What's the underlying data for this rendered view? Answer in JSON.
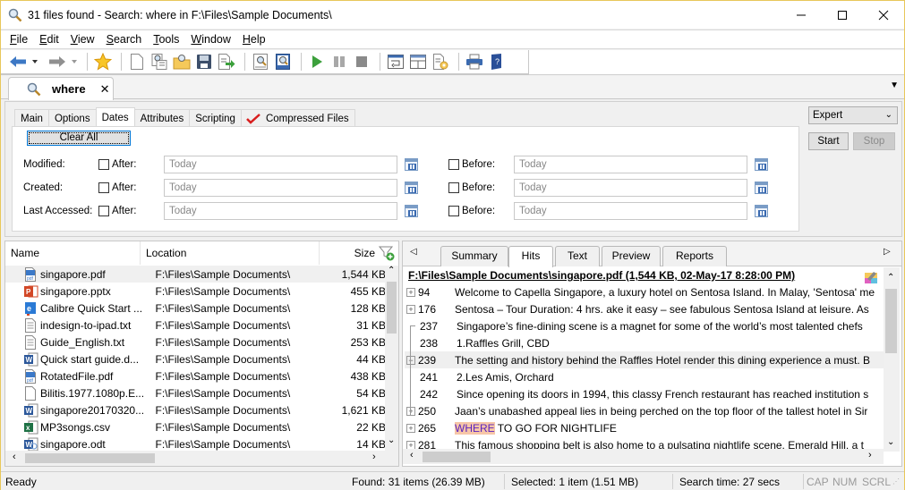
{
  "window": {
    "title": "31 files found - Search: where in F:\\Files\\Sample Documents\\",
    "minimize": "—",
    "maximize": "☐",
    "close": "✕"
  },
  "menu": [
    {
      "label": "File",
      "u": "F",
      "rest": "ile"
    },
    {
      "label": "Edit",
      "u": "E",
      "rest": "dit"
    },
    {
      "label": "View",
      "u": "V",
      "rest": "iew"
    },
    {
      "label": "Search",
      "u": "S",
      "rest": "earch"
    },
    {
      "label": "Tools",
      "u": "T",
      "rest": "ools"
    },
    {
      "label": "Window",
      "u": "W",
      "rest": "indow"
    },
    {
      "label": "Help",
      "u": "H",
      "rest": "elp"
    }
  ],
  "toolbar": {
    "icons": [
      "back-arrow-icon",
      "back-dropdown-icon",
      "forward-arrow-icon",
      "forward-dropdown-icon",
      "favorites-star-icon",
      "new-document-icon",
      "open-search-icon",
      "open-folder-icon",
      "save-disk-icon",
      "export-icon",
      "search-document-icon",
      "search-document-blue-icon",
      "start-play-icon",
      "pause-icon",
      "stop-icon",
      "wrap-icon",
      "layout-icon",
      "settings-document-icon",
      "print-icon",
      "help-book-icon"
    ]
  },
  "search_tab": {
    "label": "where",
    "close": "✕"
  },
  "tabstrip_menu": "▼",
  "options": {
    "tabs": [
      {
        "label": "Main",
        "active": false
      },
      {
        "label": "Options",
        "active": false
      },
      {
        "label": "Dates",
        "active": true
      },
      {
        "label": "Attributes",
        "active": false
      },
      {
        "label": "Scripting",
        "active": false
      },
      {
        "label": "Compressed Files",
        "active": false,
        "checked": true
      }
    ],
    "clear_all": "Clear All",
    "dates": [
      {
        "label": "Modified:",
        "after_label": "After:",
        "after_value": "Today",
        "before_label": "Before:",
        "before_value": "Today"
      },
      {
        "label": "Created:",
        "after_label": "After:",
        "after_value": "Today",
        "before_label": "Before:",
        "before_value": "Today"
      },
      {
        "label": "Last Accessed:",
        "after_label": "After:",
        "after_value": "Today",
        "before_label": "Before:",
        "before_value": "Today"
      }
    ],
    "mode_select": "Expert",
    "start": "Start",
    "stop": "Stop"
  },
  "results": {
    "columns": {
      "name": "Name",
      "location": "Location",
      "size": "Size"
    },
    "rows": [
      {
        "name": "singapore.pdf",
        "icon": "pdf",
        "location": "F:\\Files\\Sample Documents\\",
        "size": "1,544 KB",
        "selected": true
      },
      {
        "name": "singapore.pptx",
        "icon": "pptx",
        "location": "F:\\Files\\Sample Documents\\",
        "size": "455 KB"
      },
      {
        "name": "Calibre Quick Start ...",
        "icon": "epub",
        "location": "F:\\Files\\Sample Documents\\",
        "size": "128 KB"
      },
      {
        "name": "indesign-to-ipad.txt",
        "icon": "txt",
        "location": "F:\\Files\\Sample Documents\\",
        "size": "31 KB"
      },
      {
        "name": "Guide_English.txt",
        "icon": "txt",
        "location": "F:\\Files\\Sample Documents\\",
        "size": "253 KB"
      },
      {
        "name": "Quick start guide.d...",
        "icon": "doc",
        "location": "F:\\Files\\Sample Documents\\",
        "size": "44 KB"
      },
      {
        "name": "RotatedFile.pdf",
        "icon": "pdf",
        "location": "F:\\Files\\Sample Documents\\",
        "size": "438 KB"
      },
      {
        "name": "Bilitis.1977.1080p.E...",
        "icon": "blank",
        "location": "F:\\Files\\Sample Documents\\",
        "size": "54 KB"
      },
      {
        "name": "singapore20170320...",
        "icon": "doc",
        "location": "F:\\Files\\Sample Documents\\",
        "size": "1,621 KB"
      },
      {
        "name": "MP3songs.csv",
        "icon": "csv",
        "location": "F:\\Files\\Sample Documents\\",
        "size": "22 KB"
      },
      {
        "name": "singapore.odt",
        "icon": "odt",
        "location": "F:\\Files\\Sample Documents\\",
        "size": "14 KB"
      }
    ]
  },
  "preview": {
    "tabs": [
      {
        "label": "Summary",
        "active": false
      },
      {
        "label": "Hits",
        "active": true
      },
      {
        "label": "Text",
        "active": false
      },
      {
        "label": "Preview",
        "active": false
      },
      {
        "label": "Reports",
        "active": false
      }
    ],
    "header": "F:\\Files\\Sample Documents\\singapore.pdf   (1,544 KB,  02-May-17 8:28:00 PM)",
    "hits": [
      {
        "line": "94",
        "expander": "+",
        "text": "Welcome to Capella Singapore, a luxury hotel on Sentosa Island. In Malay, 'Sentosa' me"
      },
      {
        "line": "176",
        "expander": "+",
        "text": "Sentosa – Tour Duration: 4 hrs. ake it easy – see fabulous Sentosa Island at leisure. As"
      },
      {
        "line": "237",
        "expander": "",
        "text": "Singapore’s fine-dining scene is a magnet for some of the world’s most talented chefs"
      },
      {
        "line": "238",
        "expander": "",
        "text": "1.Raffles Grill, CBD"
      },
      {
        "line": "239",
        "expander": "−",
        "text": "The setting and history behind the Raffles Hotel render this dining experience a must. B",
        "highlight": true
      },
      {
        "line": "241",
        "expander": "",
        "text": "2.Les Amis, Orchard"
      },
      {
        "line": "242",
        "expander": "",
        "text": "Since opening its doors in 1994, this classy French restaurant has reached institution s"
      },
      {
        "line": "250",
        "expander": "+",
        "text": "Jaan’s unabashed appeal lies in being perched on the top floor of the tallest hotel in Sir"
      },
      {
        "line": "265",
        "expander": "+",
        "match": "WHERE",
        "text": " TO GO FOR NIGHTLIFE"
      },
      {
        "line": "281",
        "expander": "+",
        "text": "This famous shopping belt is also home to a pulsating nightlife scene. Emerald Hill, a t"
      }
    ]
  },
  "status": {
    "ready": "Ready",
    "found": "Found: 31 items (26.39 MB)",
    "selected": "Selected: 1 item (1.51 MB)",
    "search_time": "Search time: 27 secs",
    "cap": "CAP",
    "num": "NUM",
    "scrl": "SCRL"
  }
}
